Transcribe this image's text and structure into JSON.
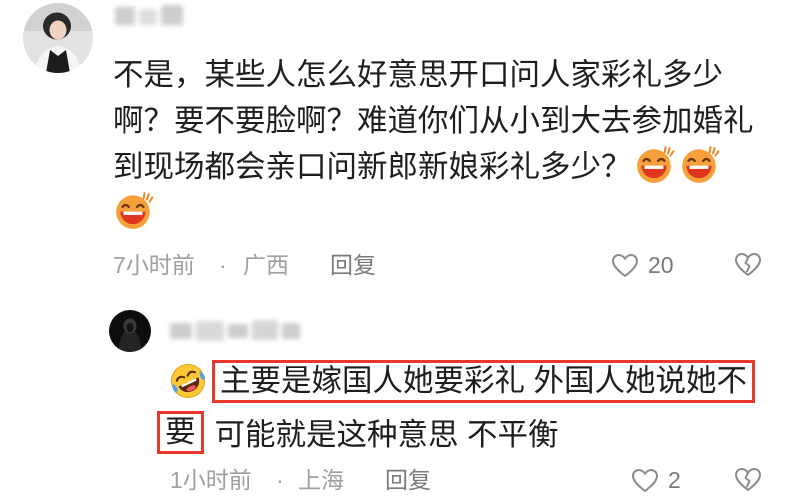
{
  "comment": {
    "avatar_icon": "user-avatar",
    "text_lines": [
      "不是，某些人怎么好意思开口问人家彩礼多少",
      "啊？要不要脸啊？难道你们从小到大去参加婚礼",
      "到现场都会亲口问新郎新娘彩礼多少？"
    ],
    "emojis": [
      "laughing-face-emoji",
      "laughing-face-emoji",
      "laughing-face-emoji"
    ],
    "time": "7小时前",
    "separator": "·",
    "location": "广西",
    "reply_label": "回复",
    "like_icon": "heart-outline-icon",
    "like_count": "20",
    "dislike_icon": "broken-heart-icon"
  },
  "reply": {
    "avatar_icon": "user-avatar",
    "emoji": "tears-of-joy-emoji",
    "highlight_1": "主要是嫁国人她要彩礼 外国人她说她不",
    "highlight_2": "要",
    "text_rest": "可能就是这种意思 不平衡",
    "time": "1小时前",
    "separator": "·",
    "location": "上海",
    "reply_label": "回复",
    "like_icon": "heart-outline-icon",
    "like_count": "2",
    "dislike_icon": "broken-heart-icon"
  },
  "colors": {
    "text": "#1e1e1e",
    "meta": "#a0a0a0",
    "action": "#7a7a7a",
    "icon": "#8c8c8c",
    "highlight_border": "#e6382b"
  }
}
